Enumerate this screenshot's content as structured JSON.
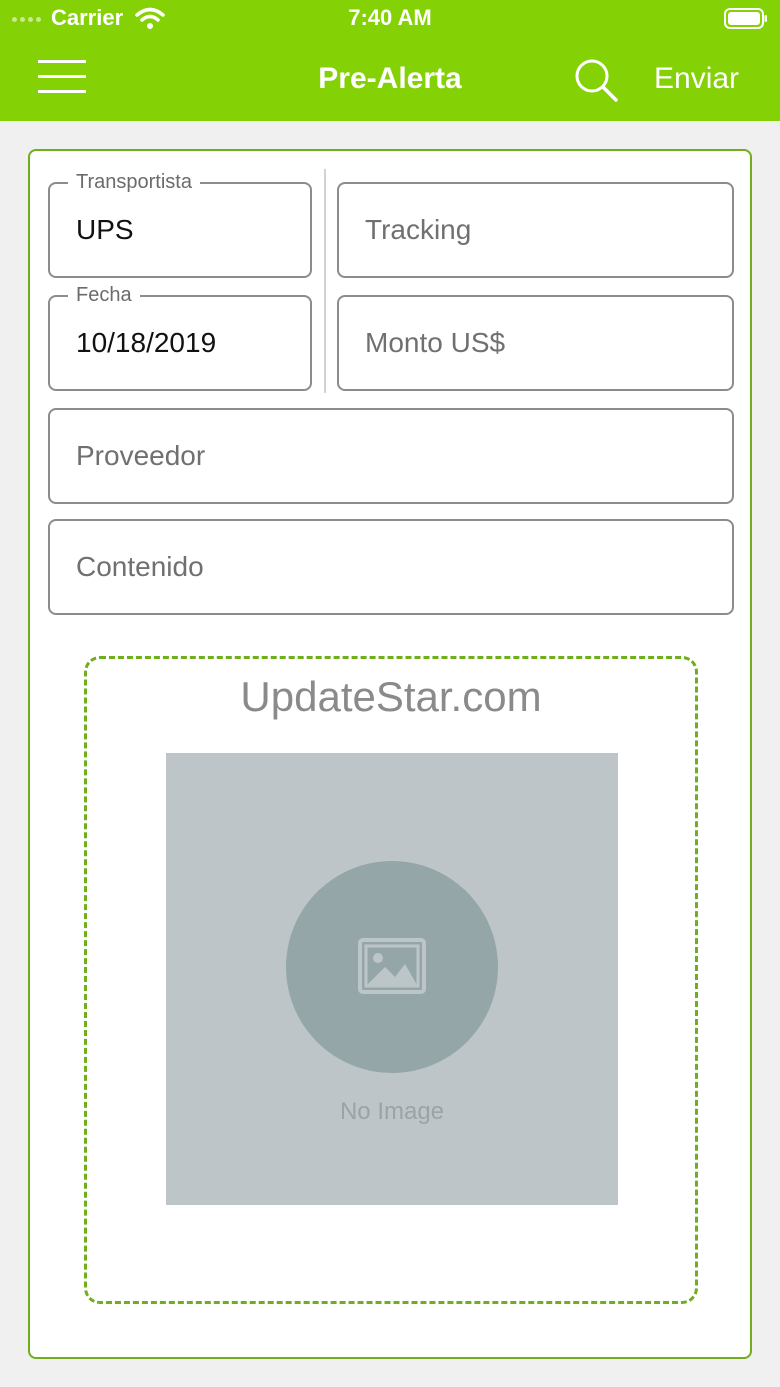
{
  "status_bar": {
    "carrier": "Carrier",
    "time": "7:40 AM"
  },
  "nav": {
    "title": "Pre-Alerta",
    "send_label": "Enviar",
    "menu_icon": "hamburger-menu-icon",
    "search_icon": "search-icon"
  },
  "form": {
    "carrier_field": {
      "label": "Transportista",
      "value": "UPS"
    },
    "tracking_field": {
      "placeholder": "Tracking"
    },
    "date_field": {
      "label": "Fecha",
      "value": "10/18/2019"
    },
    "amount_field": {
      "placeholder": "Monto US$"
    },
    "supplier_field": {
      "placeholder": "Proveedor"
    },
    "content_field": {
      "placeholder": "Contenido"
    }
  },
  "image_upload": {
    "watermark": "UpdateStar.com",
    "no_image_label": "No Image",
    "icon": "image-placeholder-icon"
  },
  "colors": {
    "accent": "#84d106",
    "card_border": "#6fae1c",
    "field_border": "#8c8c8c",
    "placeholder_bg": "#bec5c8"
  }
}
